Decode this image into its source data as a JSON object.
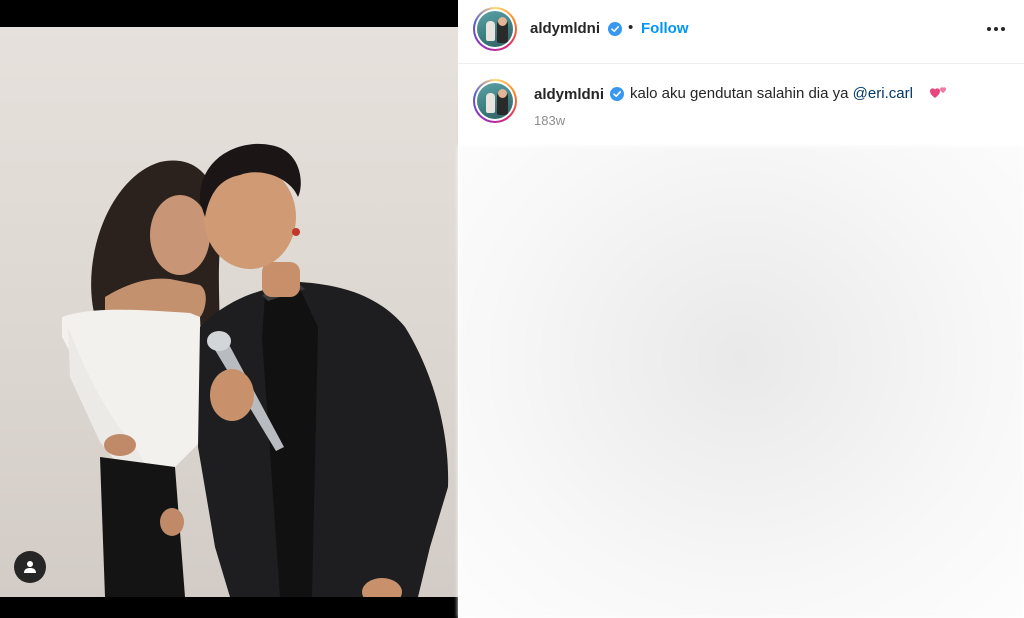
{
  "post": {
    "photo_alt_icon": "person-silhouette-icon",
    "tag_icon": "user-tag-icon"
  },
  "header": {
    "username": "aldymldni",
    "separator": "•",
    "follow_label": "Follow",
    "verified_icon": "verified-badge-icon",
    "more_icon": "more-options-icon"
  },
  "caption": {
    "username": "aldymldni",
    "text": "kalo aku gendutan salahin dia ya ",
    "mention": "@eri.carl",
    "emoji_icon": "two-hearts-icon",
    "timestamp": "183w"
  },
  "colors": {
    "follow_blue": "#0095f6",
    "verified_blue": "#3897f0",
    "mention": "#00376b",
    "heart_pink": "#e8457c"
  }
}
